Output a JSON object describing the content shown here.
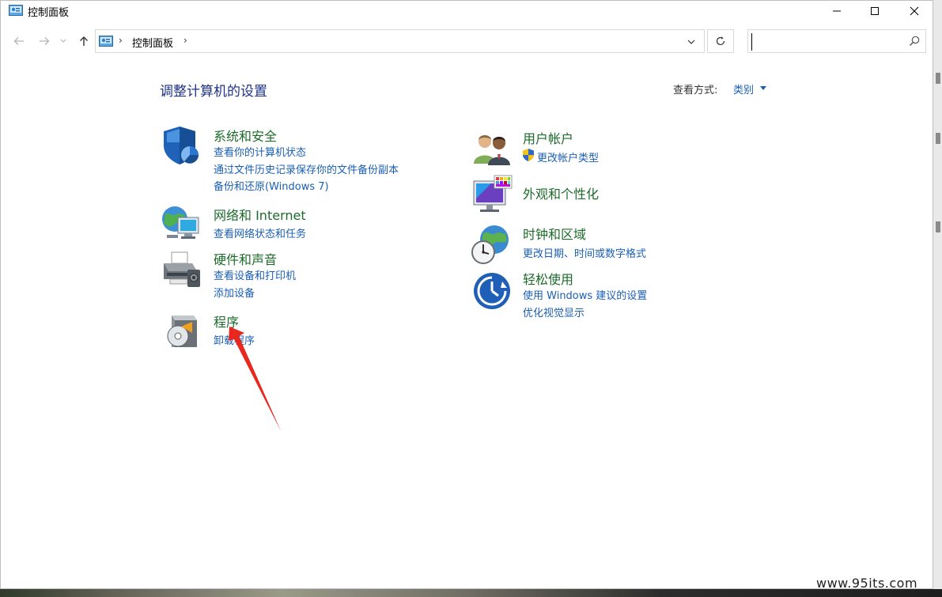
{
  "window": {
    "title": "控制面板"
  },
  "address_bar": {
    "breadcrumb": "控制面板",
    "separator": "›"
  },
  "search": {
    "value": "",
    "placeholder": ""
  },
  "content": {
    "page_title": "调整计算机的设置",
    "view_by_label": "查看方式:",
    "view_by_value": "类别"
  },
  "categories": [
    {
      "icon": "shield-security-icon",
      "title": "系统和安全",
      "links": [
        "查看你的计算机状态",
        "通过文件历史记录保存你的文件备份副本",
        "备份和还原(Windows 7)"
      ]
    },
    {
      "icon": "network-globe-icon",
      "title": "网络和 Internet",
      "links": [
        "查看网络状态和任务"
      ]
    },
    {
      "icon": "printer-icon",
      "title": "硬件和声音",
      "links": [
        "查看设备和打印机",
        "添加设备"
      ]
    },
    {
      "icon": "programs-disc-icon",
      "title": "程序",
      "links": [
        "卸载程序"
      ]
    },
    {
      "icon": "users-icon",
      "title": "用户帐户",
      "links": [
        "更改帐户类型"
      ]
    },
    {
      "icon": "monitor-palette-icon",
      "title": "外观和个性化",
      "links": []
    },
    {
      "icon": "clock-globe-icon",
      "title": "时钟和区域",
      "links": [
        "更改日期、时间或数字格式"
      ]
    },
    {
      "icon": "ease-of-access-icon",
      "title": "轻松使用",
      "links": [
        "使用 Windows 建议的设置",
        "优化视觉显示"
      ]
    }
  ],
  "watermark": "www.95its.com",
  "colors": {
    "title_blue": "#1e3287",
    "category_green": "#1c6b2a",
    "link_blue": "#1a5fb4",
    "annotation_arrow": "#e8281f"
  }
}
